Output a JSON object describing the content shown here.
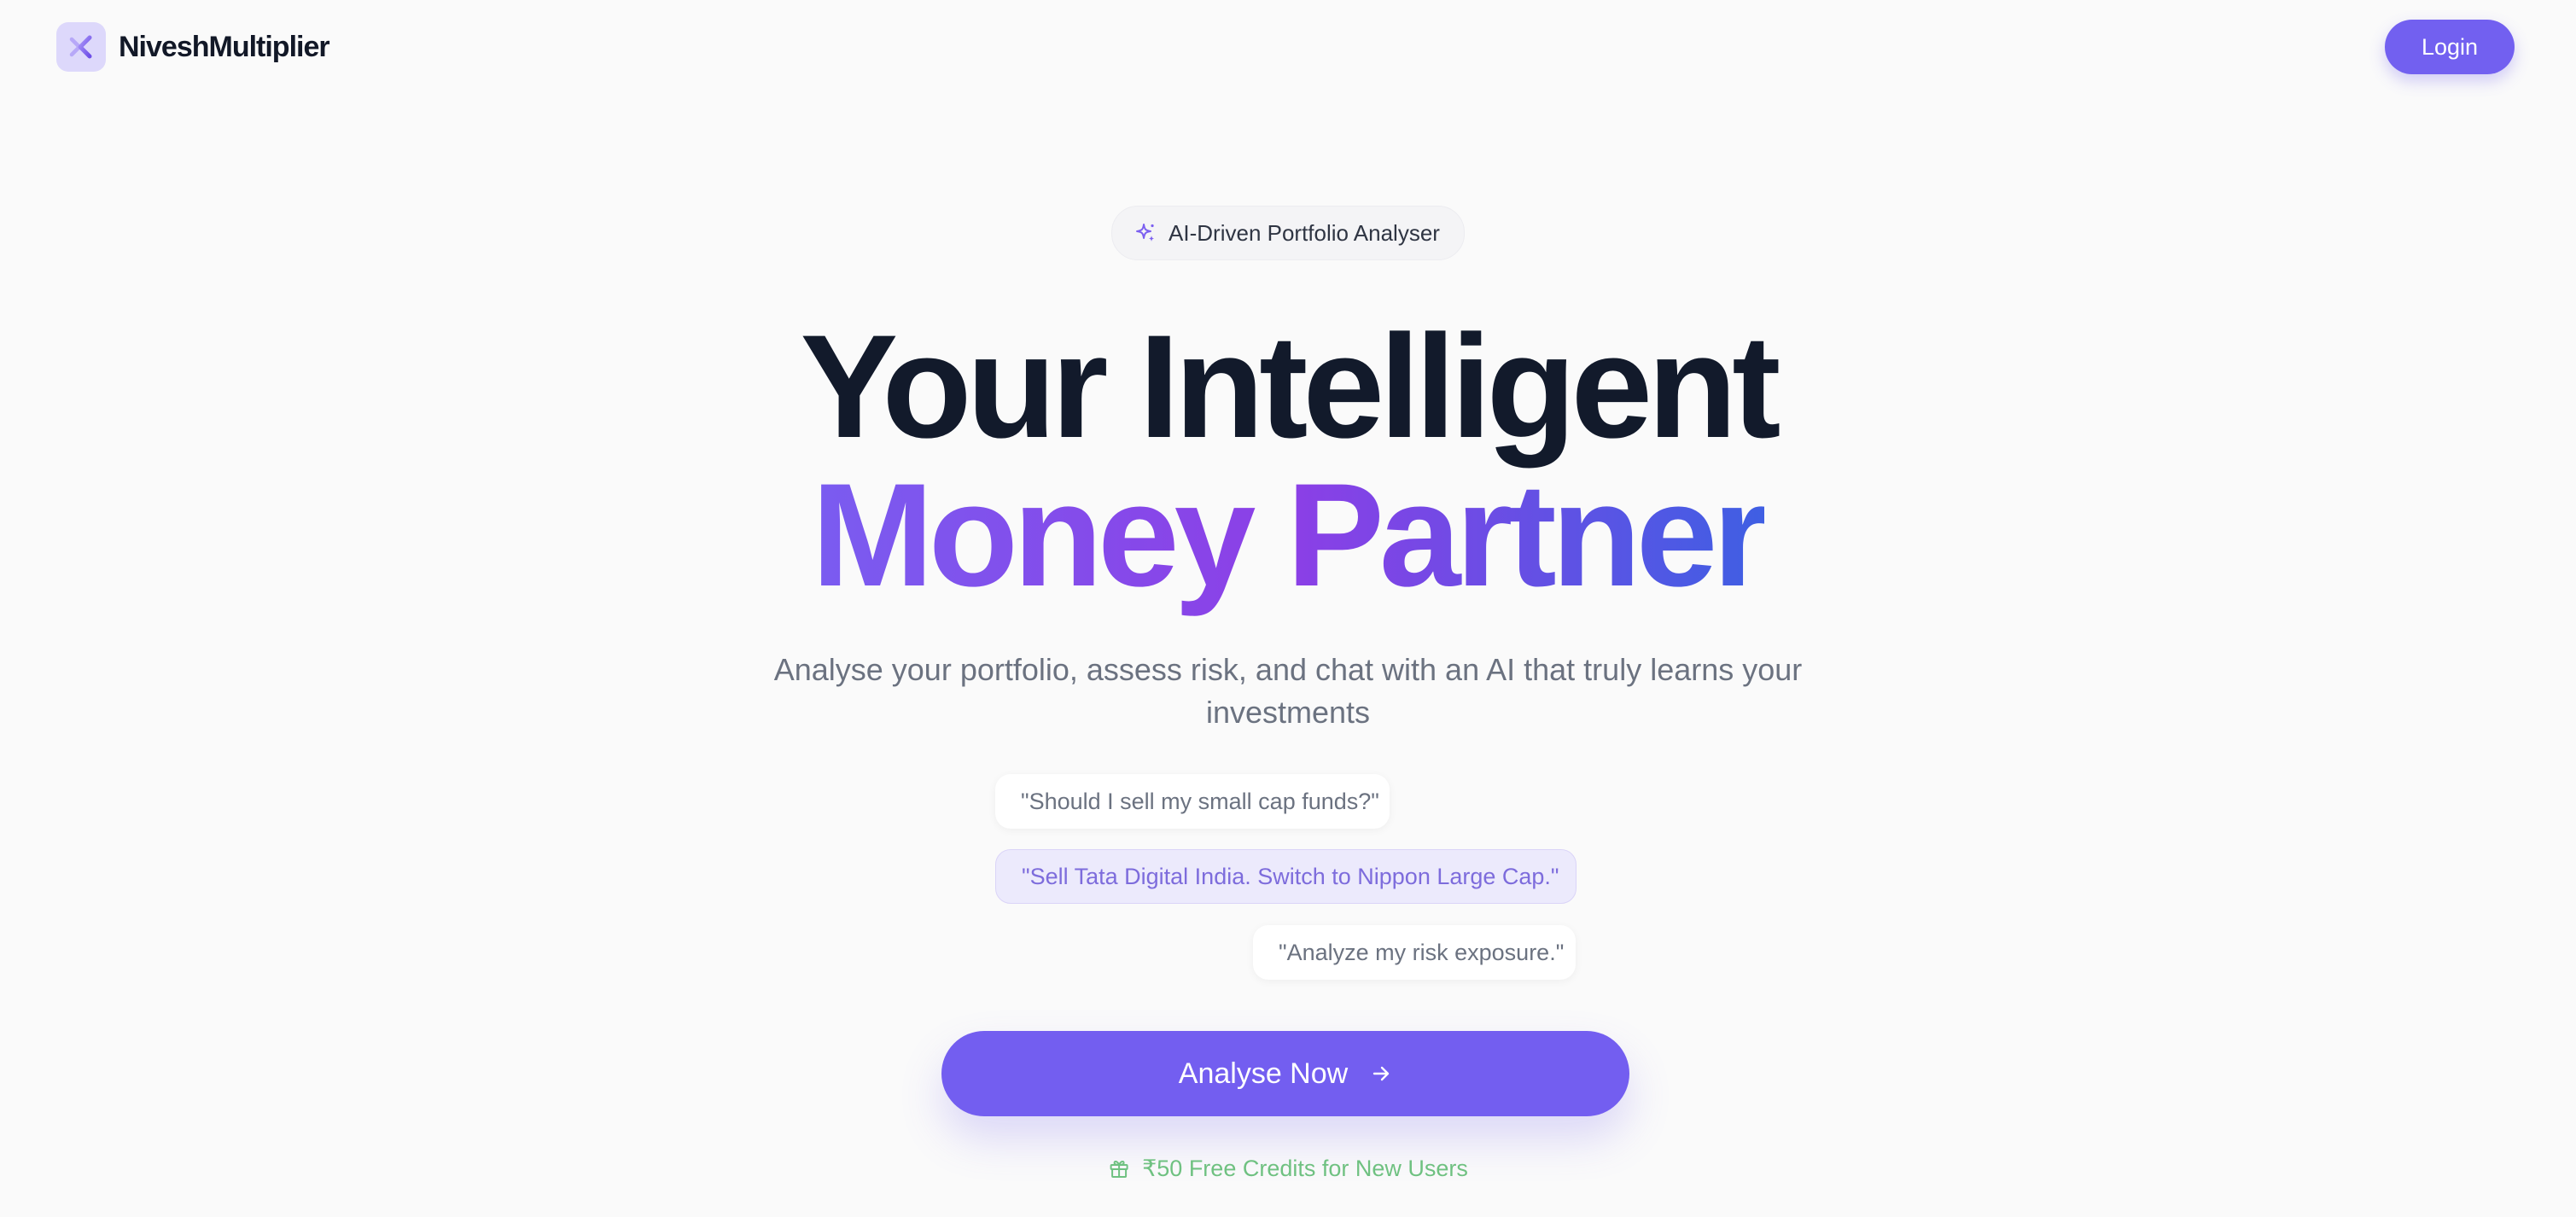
{
  "header": {
    "brand_name": "NiveshMultiplier",
    "logo_icon": "x-multiplier-logo-icon",
    "login_label": "Login"
  },
  "badge": {
    "icon": "sparkle-icon",
    "label": "AI-Driven Portfolio Analyser"
  },
  "hero": {
    "line1": "Your Intelligent",
    "line2": "Money Partner",
    "subtitle": "Analyse your portfolio, assess risk, and chat with an AI that truly learns your investments"
  },
  "chat_examples": [
    {
      "role": "user",
      "text": "\"Should I sell my small cap funds?\""
    },
    {
      "role": "ai",
      "text": "\"Sell Tata Digital India. Switch to Nippon Large Cap.\""
    },
    {
      "role": "user",
      "text": "\"Analyze my risk exposure.\""
    }
  ],
  "cta": {
    "label": "Analyse Now",
    "icon": "arrow-right-icon"
  },
  "credits": {
    "icon": "gift-icon",
    "text": "₹50 Free Credits for New Users"
  },
  "colors": {
    "accent": "#735ef0",
    "gradient_start": "#7a5cf0",
    "gradient_mid": "#8c3fe6",
    "gradient_end": "#3f5fe3",
    "credits_green": "#6fc181",
    "heading": "#121a2b"
  }
}
